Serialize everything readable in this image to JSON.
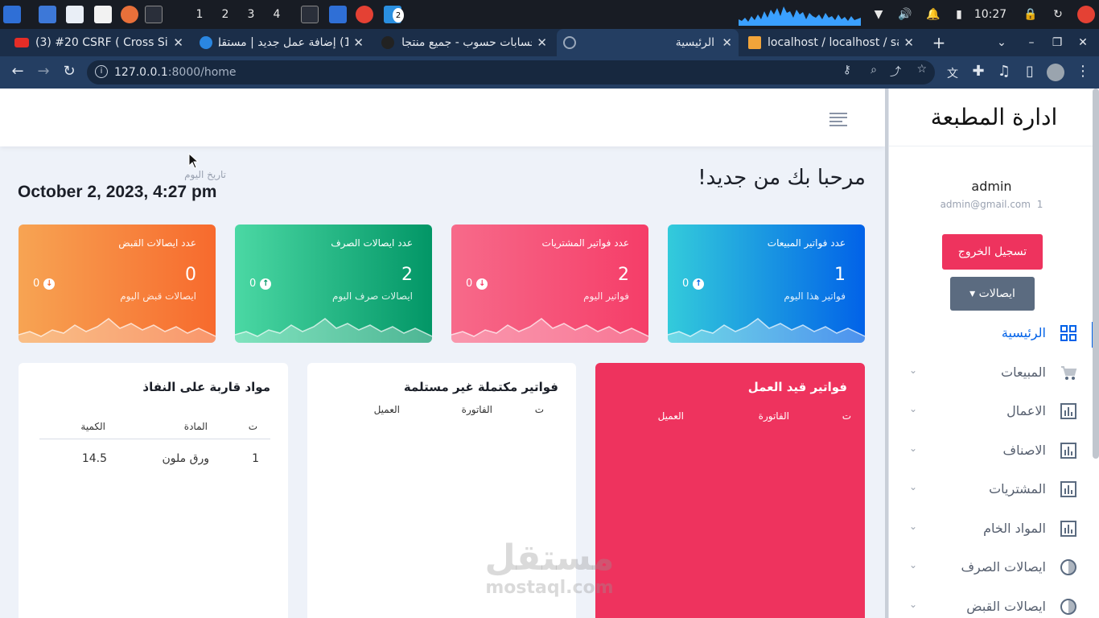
{
  "taskbar": {
    "workspaces": [
      "1",
      "2",
      "3",
      "4"
    ],
    "time": "10:27",
    "vscode_badge": "2"
  },
  "browser": {
    "tabs": [
      {
        "title": "(3) #20 CSRF ( Cross Site"
      },
      {
        "title": "(1) إضافة عمل جديد | مستقل",
        "badge": "1"
      },
      {
        "title": "حسابات حسوب - جميع منتجات"
      },
      {
        "title": "الرئيسية"
      },
      {
        "title": "localhost / localhost / sa"
      }
    ],
    "new_tab": "+",
    "url_host": "127.0.0.1",
    "url_path": ":8000/home"
  },
  "app": {
    "brand": "ادارة المطبعة",
    "user_name": "admin",
    "user_email": "admin@gmail.com",
    "user_badge": "1",
    "logout_label": "تسجيل الخروج",
    "receipts_label": "ايصالات",
    "menu": [
      {
        "label": "الرئيسية",
        "icon": "dashboard-icon",
        "active": true
      },
      {
        "label": "المبيعات",
        "icon": "cart-icon"
      },
      {
        "label": "الاعمال",
        "icon": "bar-chart-icon"
      },
      {
        "label": "الاصناف",
        "icon": "bar-chart-icon"
      },
      {
        "label": "المشتريات",
        "icon": "bar-chart-icon"
      },
      {
        "label": "المواد الخام",
        "icon": "bar-chart-icon"
      },
      {
        "label": "ايصالات الصرف",
        "icon": "half-circle-icon"
      },
      {
        "label": "ايصالات القبض",
        "icon": "half-circle-icon"
      }
    ],
    "welcome": "مرحبا بك من جديد!",
    "date_label": "تاريخ اليوم",
    "date_value": "October 2, 2023, 4:27 pm",
    "cards": [
      {
        "title": "عدد فواتير المبيعات",
        "value": "1",
        "subtitle": "فواتير هذا اليوم",
        "side": "0",
        "dir": "up",
        "color_from": "#0162e8",
        "color_to": "#33cbdb"
      },
      {
        "title": "عدد فواتير المشتريات",
        "value": "2",
        "subtitle": "فواتير اليوم",
        "side": "0",
        "dir": "down",
        "color_from": "#f53d68",
        "color_to": "#f76a8a"
      },
      {
        "title": "عدد ايصالات الصرف",
        "value": "2",
        "subtitle": "ايصالات صرف اليوم",
        "side": "0",
        "dir": "up",
        "color_from": "#029666",
        "color_to": "#4bd8a4"
      },
      {
        "title": "عدد ايصالات القبض",
        "value": "0",
        "subtitle": "ايصالات قبض اليوم",
        "side": "0",
        "dir": "down",
        "color_from": "#f76a2d",
        "color_to": "#f7a453"
      }
    ],
    "panels": {
      "in_progress": {
        "title": "فواتير قيد العمل",
        "headers": [
          "ت",
          "الفاتورة",
          "العميل"
        ]
      },
      "not_received": {
        "title": "فواتير مكتملة غير مستلمة",
        "headers": [
          "ت",
          "الفاتورة",
          "العميل"
        ]
      },
      "low_stock": {
        "title": "مواد قاربة على النفاذ",
        "headers": [
          "ت",
          "المادة",
          "الكمية"
        ],
        "rows": [
          {
            "n": "1",
            "material": "ورق ملون",
            "qty": "14.5"
          }
        ]
      }
    },
    "watermark": {
      "arabic": "مستقل",
      "latin": "mostaql.com"
    }
  }
}
